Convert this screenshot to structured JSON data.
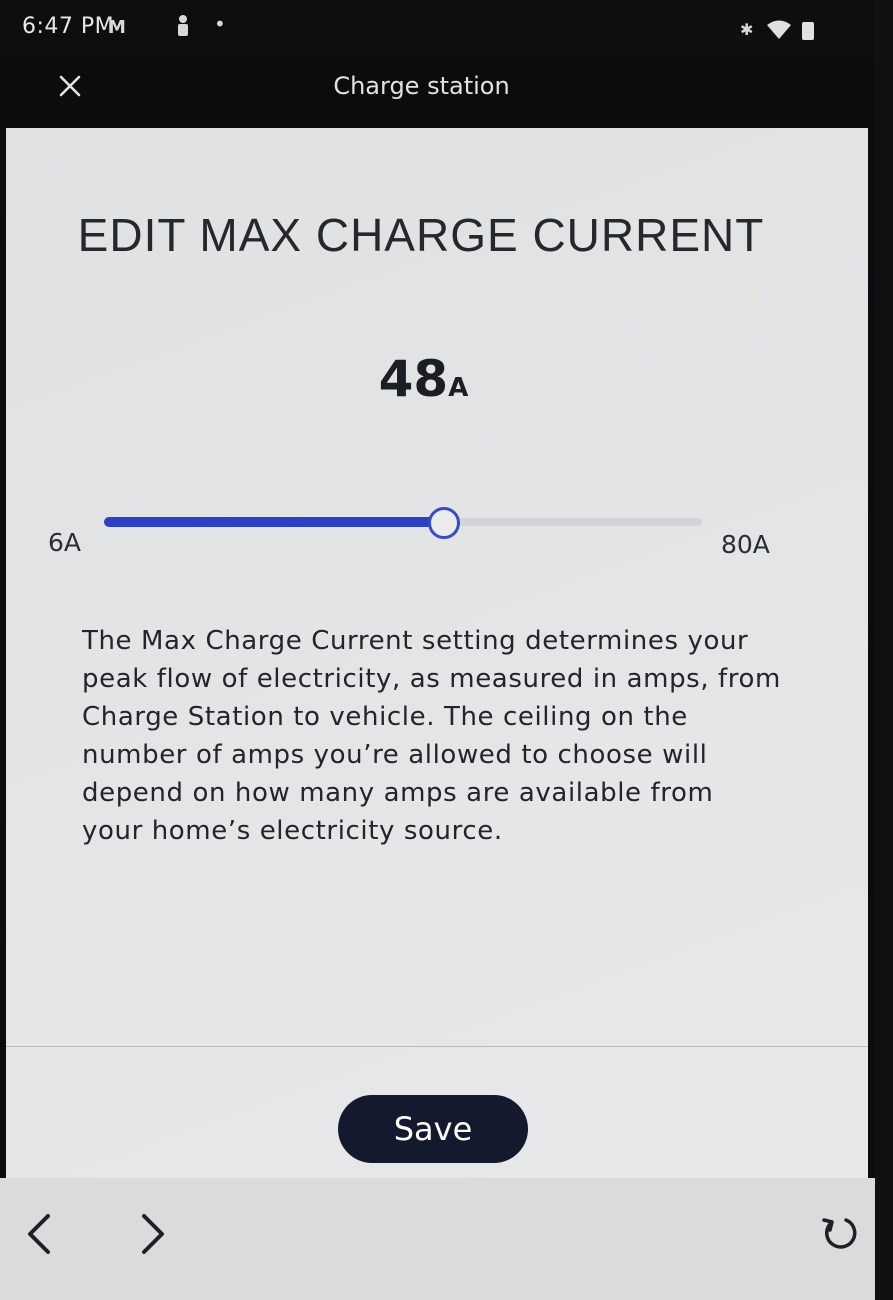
{
  "status_bar": {
    "time": "6:47 PM",
    "icons": [
      "gmail-icon",
      "person-icon",
      "dot-icon",
      "bluetooth-icon",
      "wifi-icon",
      "battery-icon"
    ]
  },
  "header": {
    "title": "Charge station",
    "close_icon": "close-icon"
  },
  "page": {
    "title": "EDIT MAX CHARGE CURRENT",
    "current_value": "48",
    "current_unit": "A"
  },
  "slider": {
    "min_label": "6A",
    "max_label": "80A",
    "min": 6,
    "max": 80,
    "value": 48,
    "fill_color": "#2f3fc4"
  },
  "description": "The Max Charge Current setting determines your peak flow of electricity, as measured in amps, from Charge Station to vehicle. The ceiling on the number of amps you’re allowed to choose will depend on how many amps are available from your home’s electricity source.",
  "actions": {
    "save_label": "Save"
  },
  "bottom_nav": {
    "back_icon": "chevron-left-icon",
    "forward_icon": "chevron-right-icon",
    "refresh_icon": "refresh-icon"
  }
}
